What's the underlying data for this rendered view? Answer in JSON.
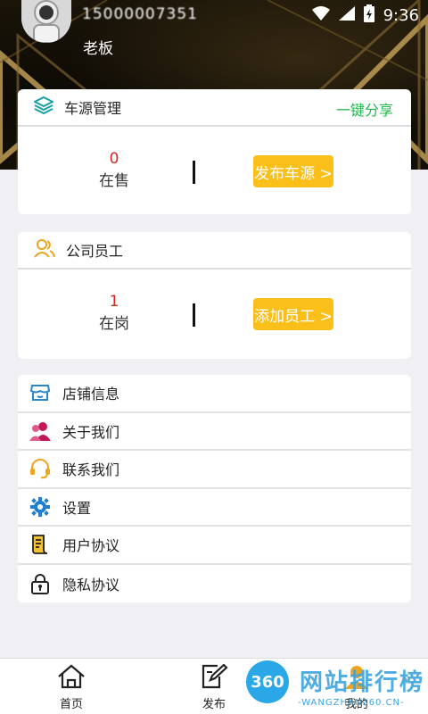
{
  "status_bar": {
    "phone": "15000007351",
    "time": "9:36"
  },
  "profile": {
    "name": "老板"
  },
  "vehicle_card": {
    "title": "车源管理",
    "share_label": "一键分享",
    "count": "0",
    "count_label": "在售",
    "button_label": "发布车源 >"
  },
  "staff_card": {
    "title": "公司员工",
    "count": "1",
    "count_label": "在岗",
    "button_label": "添加员工 >"
  },
  "menu": [
    {
      "label": "店铺信息",
      "icon": "store-icon"
    },
    {
      "label": "关于我们",
      "icon": "users-icon"
    },
    {
      "label": "联系我们",
      "icon": "headset-icon"
    },
    {
      "label": "设置",
      "icon": "gear-icon"
    },
    {
      "label": "用户协议",
      "icon": "document-icon"
    },
    {
      "label": "隐私协议",
      "icon": "lock-icon"
    }
  ],
  "tabs": [
    {
      "label": "首页",
      "icon": "home-icon"
    },
    {
      "label": "发布",
      "icon": "edit-icon"
    },
    {
      "label": "我的",
      "icon": "user-icon"
    }
  ],
  "watermark": {
    "badge": "360",
    "title": "网站排行榜",
    "subtitle": "-WANGZHAN360.CN-"
  },
  "colors": {
    "accent_green": "#1fb84b",
    "button_yellow": "#fbbf1a",
    "count_red": "#d7261e"
  }
}
